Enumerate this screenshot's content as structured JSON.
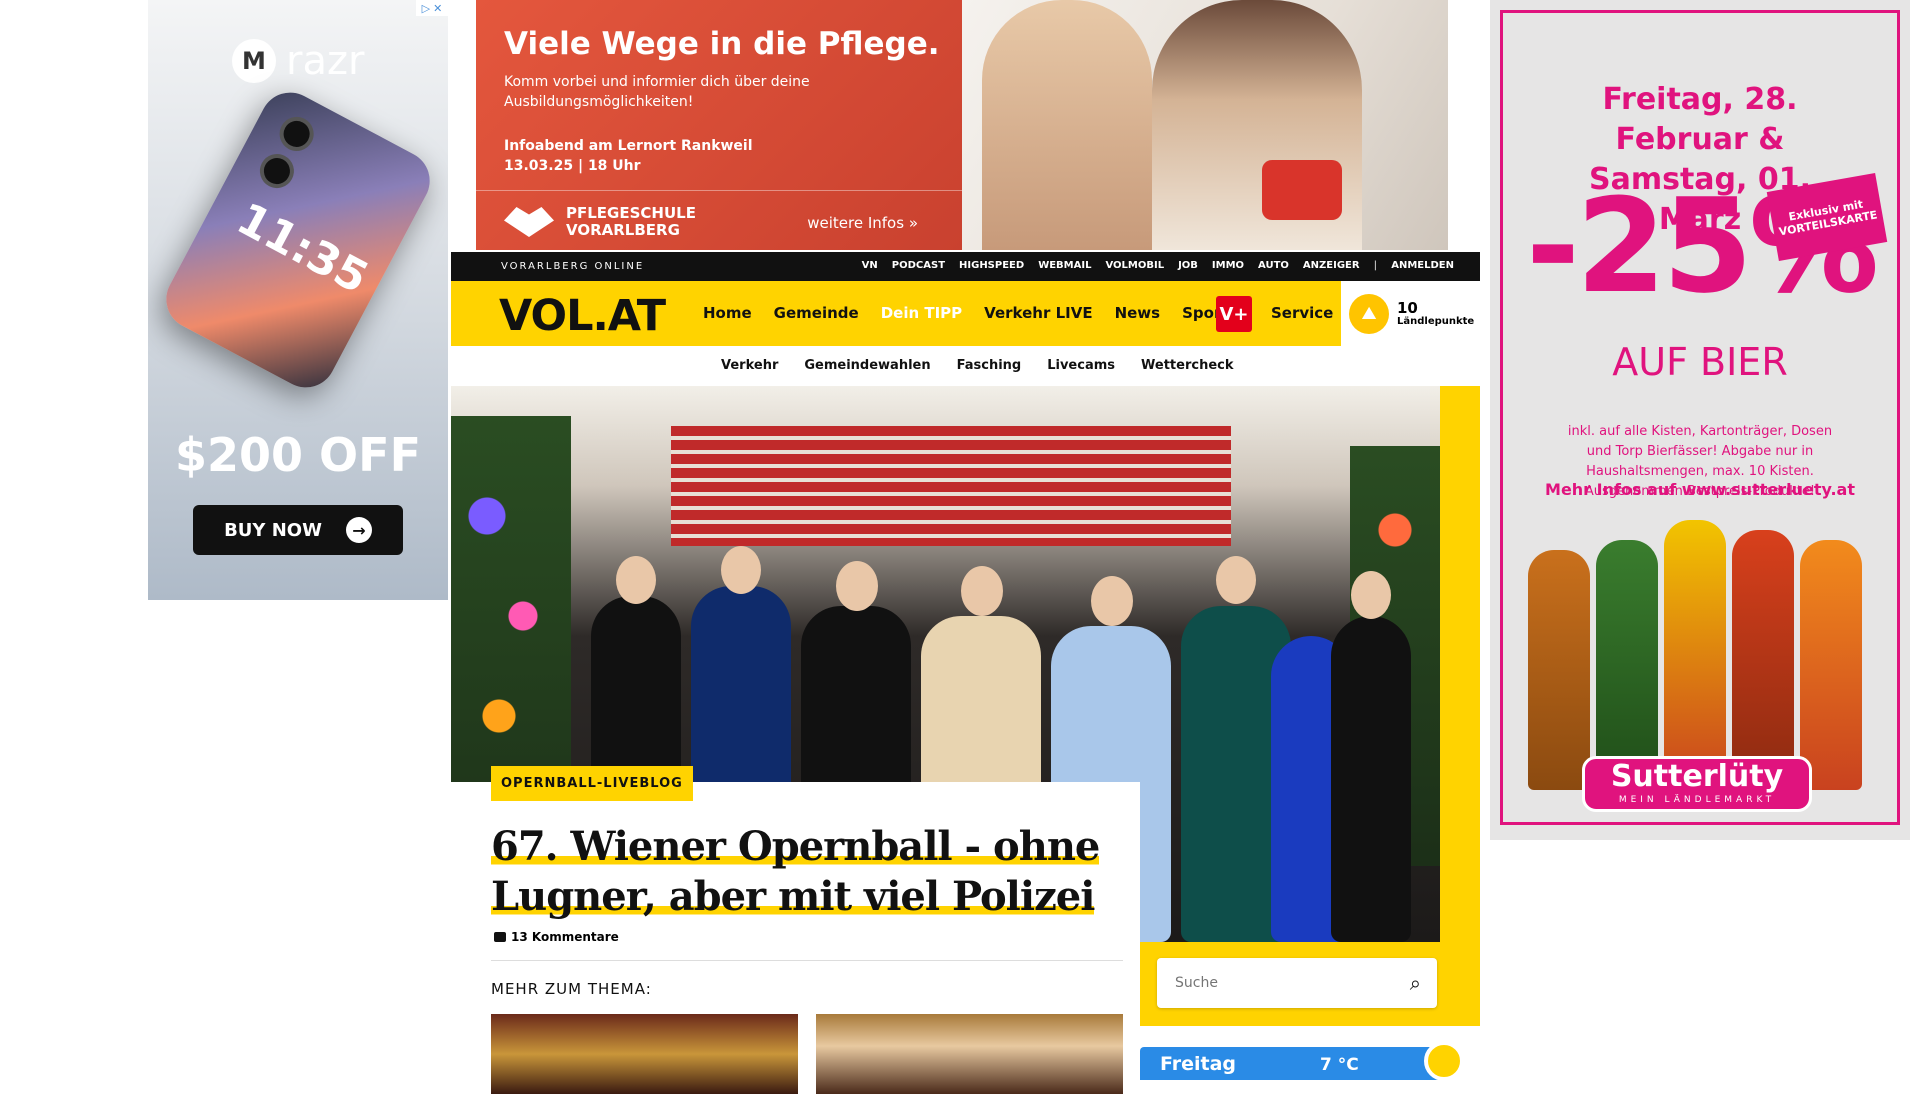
{
  "ad_left": {
    "brand": "razr",
    "logo_icon": "motorola-logo-icon",
    "phone_time": "11:35",
    "price": "$200 OFF",
    "cta": "BUY NOW",
    "arrow_icon": "arrow-right-circle-icon"
  },
  "banner": {
    "title": "Viele Wege in die Pflege.",
    "subtitle": "Komm vorbei und informier dich über deine Ausbildungsmöglichkeiten!",
    "info": "Infoabend am Lernort Rankweil 13.03.25 | 18 Uhr",
    "school": "PFLEGESCHULE VORARLBERG",
    "more": "weitere Infos »"
  },
  "ad_right": {
    "date": "Freitag, 28. Februar & Samstag, 01. März",
    "discount": "-25%",
    "badge": "Exklusiv mit VORTEILSKARTE",
    "category": "AUF BIER",
    "fineprint": "inkl. auf alle Kisten, Kartonträger, Dosen und Torp Bierfässer! Abgabe nur in Haushaltsmengen, max. 10 Kisten. Ausgenommen Bestpreis-Produkte!",
    "link": "Mehr Infos auf www.sutterluety.at",
    "store": "Sutterlüty",
    "store_sub": "MEIN LÄNDLEMARKT"
  },
  "topbar": {
    "site": "VORARLBERG ONLINE",
    "links": [
      "VN",
      "PODCAST",
      "HIGHSPEED",
      "WEBMAIL",
      "VOLMOBIL",
      "JOB",
      "IMMO",
      "AUTO",
      "ANZEIGER"
    ],
    "separator": "|",
    "login": "ANMELDEN"
  },
  "nav": {
    "logo": "VOL.AT",
    "items": [
      "Home",
      "Gemeinde",
      "Dein TIPP",
      "Verkehr LIVE",
      "News",
      "Sport"
    ],
    "vplus": "V+",
    "service": "Service",
    "points_value": "10",
    "points_label": "Ländlepunkte",
    "points_icon": "mountain-sun-icon",
    "accent": "#ffd300"
  },
  "subnav": {
    "items": [
      "Verkehr",
      "Gemeindewahlen",
      "Fasching",
      "Livecams",
      "Wettercheck"
    ]
  },
  "article": {
    "tag": "OPERNBALL-LIVEBLOG",
    "headline": "67. Wiener Opernball - ohne Lugner, aber mit viel Polizei",
    "comments": "13 Kommentare",
    "comment_icon": "comment-icon",
    "mehr": "MEHR ZUM THEMA:"
  },
  "search": {
    "placeholder": "Suche",
    "icon": "search-icon"
  },
  "weather": {
    "day": "Freitag",
    "temp": "7 °C"
  }
}
